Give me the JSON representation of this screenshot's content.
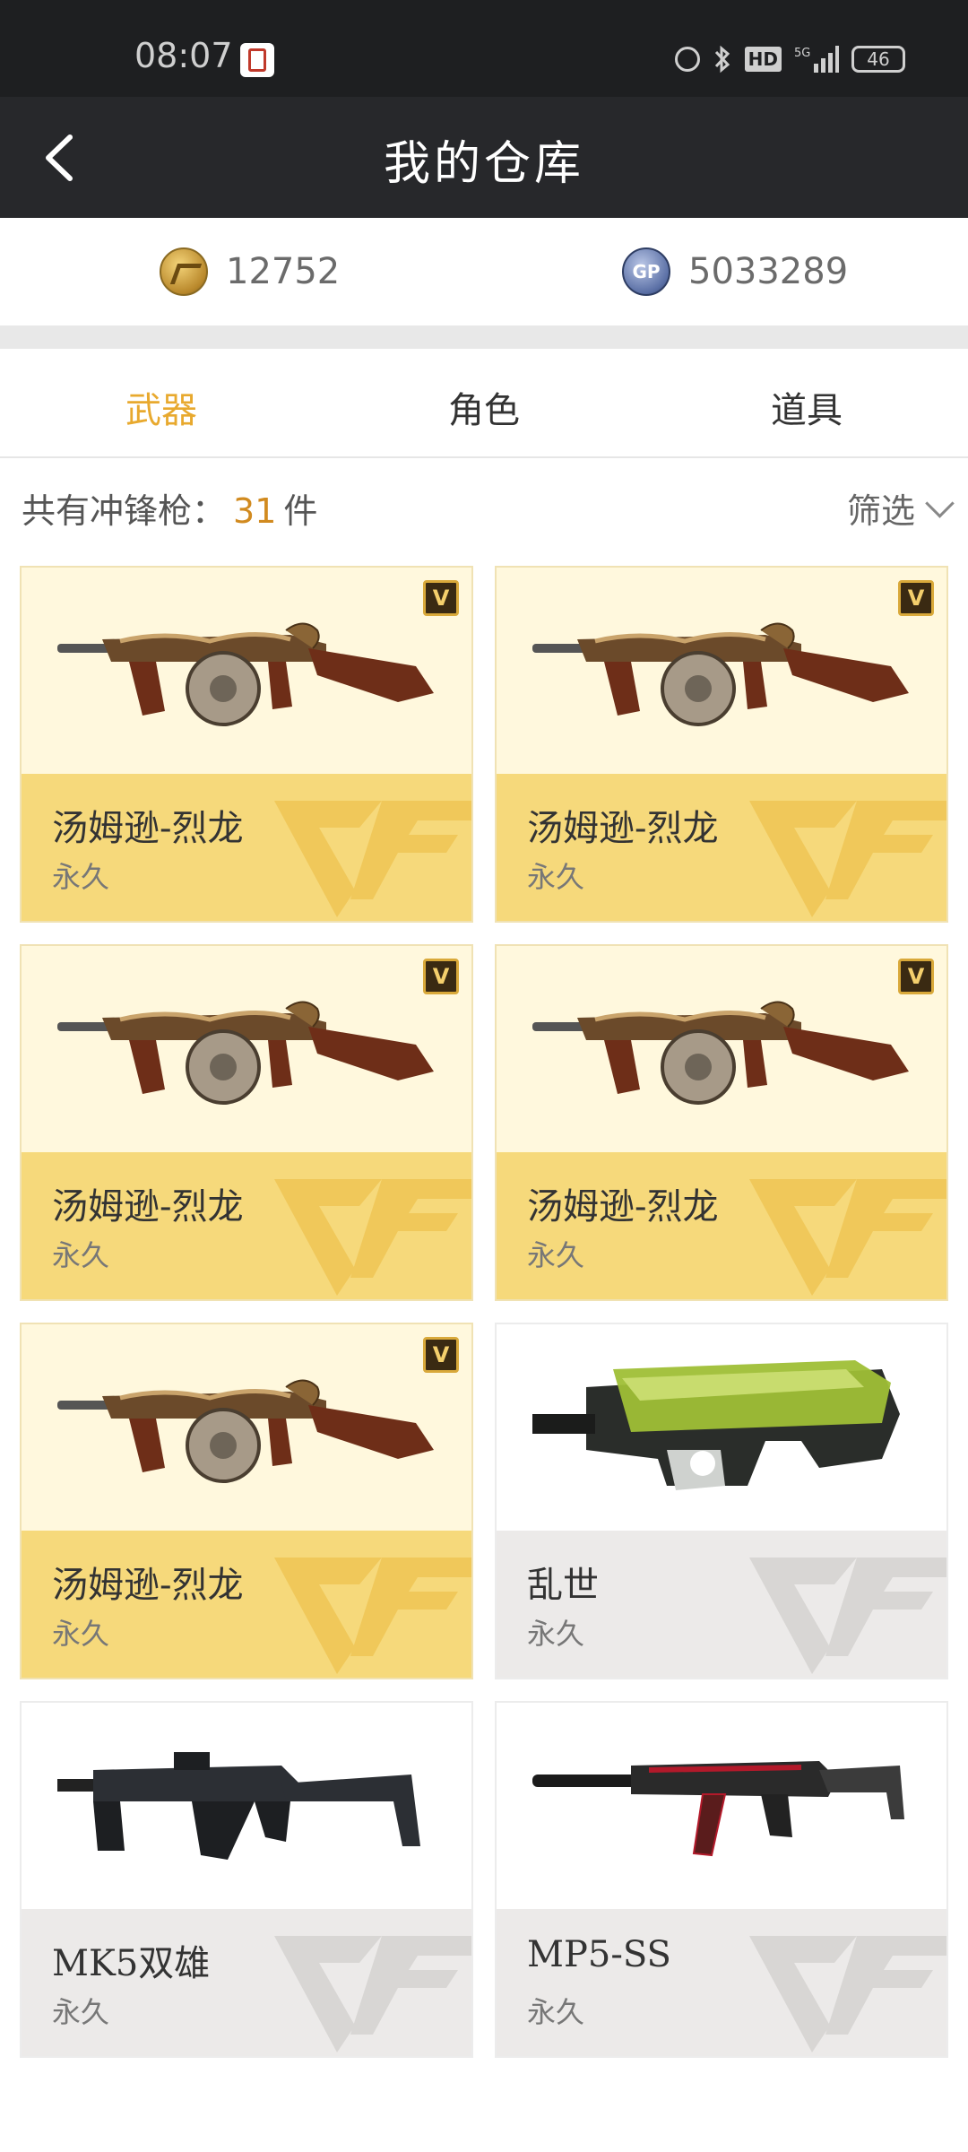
{
  "status_bar": {
    "time": "08:07",
    "network": "5G",
    "hd": "HD",
    "battery": "46"
  },
  "header": {
    "title": "我的仓库"
  },
  "currency": {
    "cf_points": "12752",
    "gp_label": "GP",
    "gp_points": "5033289"
  },
  "tabs": [
    {
      "label": "武器",
      "active": true
    },
    {
      "label": "角色",
      "active": false
    },
    {
      "label": "道具",
      "active": false
    }
  ],
  "summary": {
    "prefix": "共有冲锋枪：",
    "count": "31",
    "suffix": "件",
    "filter_label": "筛选"
  },
  "vip_badge": "V",
  "items": [
    {
      "name": "汤姆逊-烈龙",
      "duration": "永久",
      "style": "gold",
      "weapon": "thompson-dragon"
    },
    {
      "name": "汤姆逊-烈龙",
      "duration": "永久",
      "style": "gold",
      "weapon": "thompson-dragon"
    },
    {
      "name": "汤姆逊-烈龙",
      "duration": "永久",
      "style": "gold",
      "weapon": "thompson-dragon"
    },
    {
      "name": "汤姆逊-烈龙",
      "duration": "永久",
      "style": "gold",
      "weapon": "thompson-dragon"
    },
    {
      "name": "汤姆逊-烈龙",
      "duration": "永久",
      "style": "gold",
      "weapon": "thompson-dragon"
    },
    {
      "name": "乱世",
      "duration": "永久",
      "style": "gray",
      "weapon": "p90-green"
    },
    {
      "name": "MK5双雄",
      "duration": "永久",
      "style": "gray",
      "weapon": "kriss-vector"
    },
    {
      "name": "MP5-SS",
      "duration": "永久",
      "style": "gray",
      "weapon": "mp5-red"
    }
  ],
  "colors": {
    "accent": "#e8a92e",
    "count": "#d18a1f",
    "gold_card": "#f6d97b",
    "gold_card_top": "#fff8dd",
    "gray_card": "#eceae9",
    "header_bg": "#27282b"
  }
}
